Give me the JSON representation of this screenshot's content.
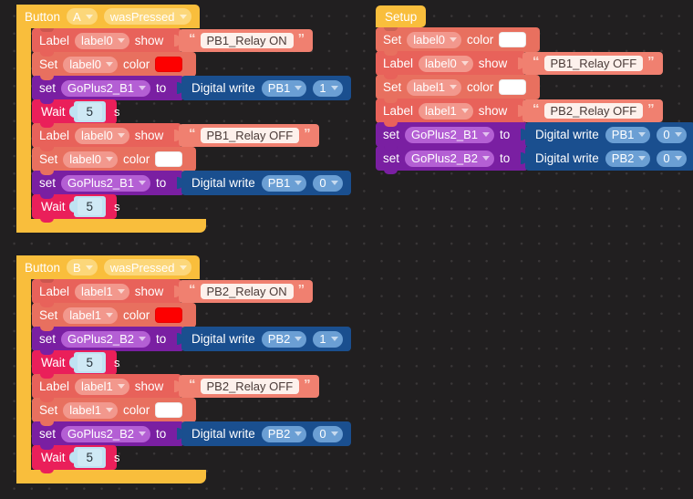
{
  "canvas": {
    "background_color": "#211f20",
    "grid_dot_color": "#3a3738"
  },
  "palette": {
    "hat_yellow": "#f9be3c",
    "label_block": "#e8625a",
    "set_block": "#e8705f",
    "set_variable_block": "#7a1fa2",
    "wait_block": "#ea1f5a",
    "digital_write_block": "#1a4f8f",
    "string_block": "#f08070",
    "number_field": "#bfe2f2",
    "swatch_red": "#fd0000",
    "swatch_white": "#ffffff"
  },
  "scripts": [
    {
      "id": "button-a-script",
      "hat": {
        "keyword": "Button",
        "button": "A",
        "event": "wasPressed"
      },
      "rows": [
        {
          "kind": "label-show",
          "verb": "Label",
          "target": "label0",
          "action": "show",
          "value": "PB1_Relay ON"
        },
        {
          "kind": "set-color",
          "verb": "Set",
          "target": "label0",
          "property": "color",
          "color": "#fd0000"
        },
        {
          "kind": "set-variable",
          "verb": "set",
          "variable": "GoPlus2_B1",
          "connector": "to",
          "value_block": "Digital write",
          "pin": "PB1",
          "level": "1"
        },
        {
          "kind": "wait",
          "verb": "Wait",
          "value": "5",
          "unit": "s"
        },
        {
          "kind": "label-show",
          "verb": "Label",
          "target": "label0",
          "action": "show",
          "value": "PB1_Relay OFF"
        },
        {
          "kind": "set-color",
          "verb": "Set",
          "target": "label0",
          "property": "color",
          "color": "#ffffff"
        },
        {
          "kind": "set-variable",
          "verb": "set",
          "variable": "GoPlus2_B1",
          "connector": "to",
          "value_block": "Digital write",
          "pin": "PB1",
          "level": "0"
        },
        {
          "kind": "wait",
          "verb": "Wait",
          "value": "5",
          "unit": "s"
        }
      ]
    },
    {
      "id": "button-b-script",
      "hat": {
        "keyword": "Button",
        "button": "B",
        "event": "wasPressed"
      },
      "rows": [
        {
          "kind": "label-show",
          "verb": "Label",
          "target": "label1",
          "action": "show",
          "value": "PB2_Relay ON"
        },
        {
          "kind": "set-color",
          "verb": "Set",
          "target": "label1",
          "property": "color",
          "color": "#fd0000"
        },
        {
          "kind": "set-variable",
          "verb": "set",
          "variable": "GoPlus2_B2",
          "connector": "to",
          "value_block": "Digital write",
          "pin": "PB2",
          "level": "1"
        },
        {
          "kind": "wait",
          "verb": "Wait",
          "value": "5",
          "unit": "s"
        },
        {
          "kind": "label-show",
          "verb": "Label",
          "target": "label1",
          "action": "show",
          "value": "PB2_Relay OFF"
        },
        {
          "kind": "set-color",
          "verb": "Set",
          "target": "label1",
          "property": "color",
          "color": "#ffffff"
        },
        {
          "kind": "set-variable",
          "verb": "set",
          "variable": "GoPlus2_B2",
          "connector": "to",
          "value_block": "Digital write",
          "pin": "PB2",
          "level": "0"
        },
        {
          "kind": "wait",
          "verb": "Wait",
          "value": "5",
          "unit": "s"
        }
      ]
    },
    {
      "id": "setup-script",
      "hat": {
        "keyword": "Setup",
        "button": "",
        "event": ""
      },
      "rows": [
        {
          "kind": "set-color",
          "verb": "Set",
          "target": "label0",
          "property": "color",
          "color": "#ffffff"
        },
        {
          "kind": "label-show",
          "verb": "Label",
          "target": "label0",
          "action": "show",
          "value": "PB1_Relay OFF"
        },
        {
          "kind": "set-color",
          "verb": "Set",
          "target": "label1",
          "property": "color",
          "color": "#ffffff"
        },
        {
          "kind": "label-show",
          "verb": "Label",
          "target": "label1",
          "action": "show",
          "value": "PB2_Relay OFF"
        },
        {
          "kind": "set-variable",
          "verb": "set",
          "variable": "GoPlus2_B1",
          "connector": "to",
          "value_block": "Digital write",
          "pin": "PB1",
          "level": "0"
        },
        {
          "kind": "set-variable",
          "verb": "set",
          "variable": "GoPlus2_B2",
          "connector": "to",
          "value_block": "Digital write",
          "pin": "PB2",
          "level": "0"
        }
      ]
    }
  ]
}
